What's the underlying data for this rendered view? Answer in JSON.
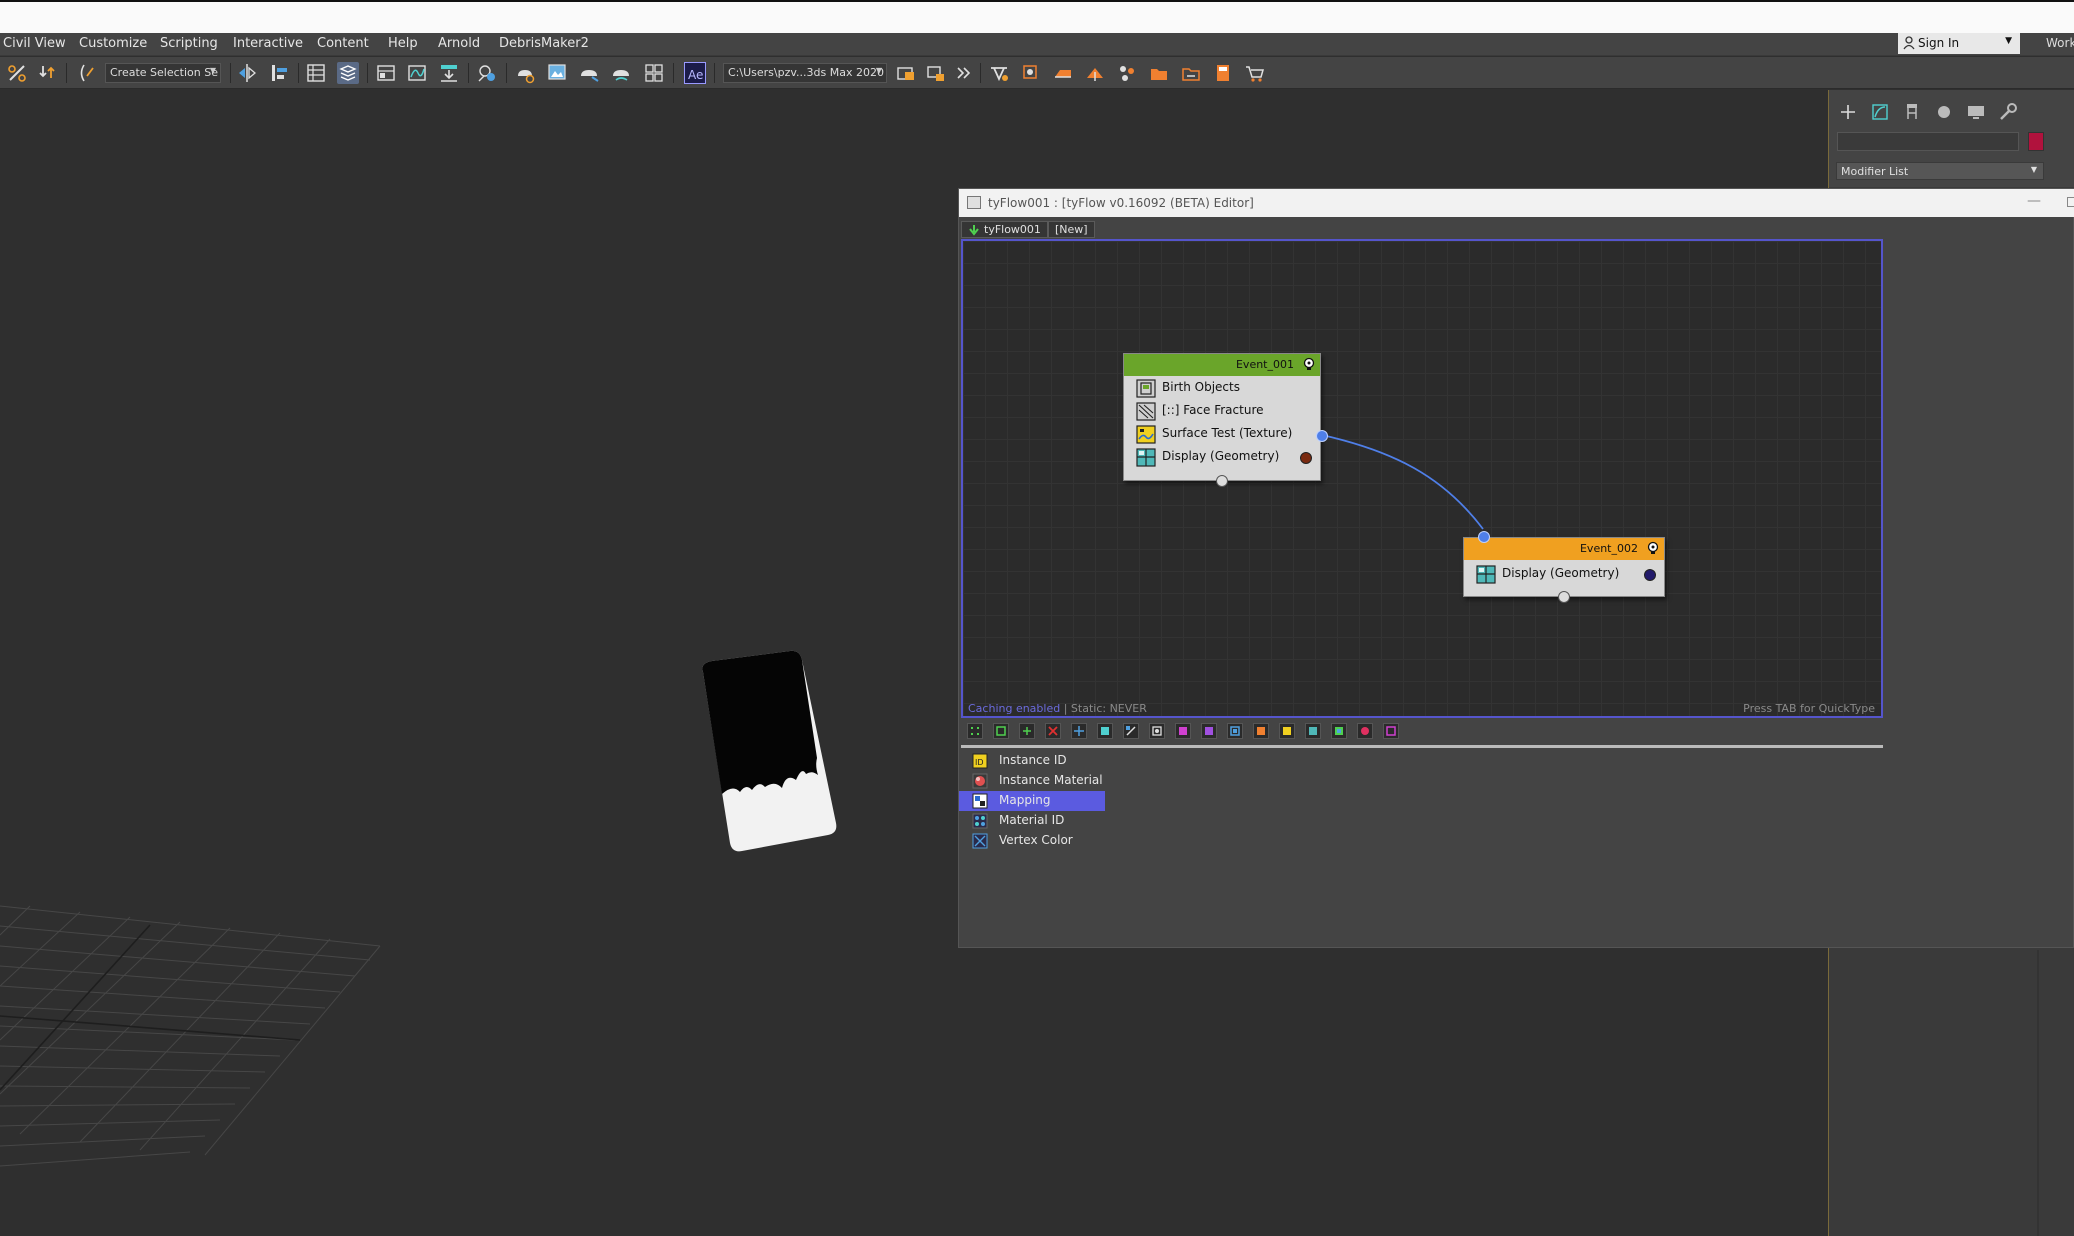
{
  "menubar": {
    "items": [
      "Civil View",
      "Customize",
      "Scripting",
      "Interactive",
      "Content",
      "Help",
      "Arnold",
      "DebrisMaker2"
    ],
    "sign_in": "Sign In",
    "workspace_partial": "Work"
  },
  "toolbar": {
    "selection_set": "Create Selection Se",
    "project_path": "C:\\Users\\pzv...3ds Max 2020"
  },
  "command_panel": {
    "tab_icons": [
      "create-icon",
      "modify-icon",
      "hierarchy-icon",
      "motion-icon",
      "display-icon",
      "utilities-icon"
    ],
    "object_color": "#b1123d",
    "modifier_list": "Modifier List"
  },
  "editor": {
    "title": "tyFlow001 : [tyFlow v0.16092 (BETA) Editor]",
    "tabs": [
      {
        "label": "tyFlow001"
      },
      {
        "label": "[New]"
      }
    ],
    "status_caching": "Caching enabled",
    "status_separator": " | ",
    "status_static": "Static: NEVER",
    "hint": "Press TAB for QuickType",
    "events": [
      {
        "name": "Event_001",
        "header_color": "#6aa52a",
        "operators": [
          {
            "label": "Birth Objects",
            "icon": "birth-objects-icon"
          },
          {
            "label": "[::] Face Fracture",
            "icon": "face-fracture-icon"
          },
          {
            "label": "Surface Test (Texture)",
            "icon": "surface-test-icon"
          },
          {
            "label": "Display (Geometry)",
            "icon": "display-geometry-icon",
            "dot_color": "#7a2a10"
          }
        ]
      },
      {
        "name": "Event_002",
        "header_color": "#f0a020",
        "operators": [
          {
            "label": "Display (Geometry)",
            "icon": "display-geometry-icon",
            "dot_color": "#221a6a"
          }
        ]
      }
    ],
    "wire_color": "#4f7fe8",
    "operator_list": [
      {
        "label": "Instance ID",
        "icon": "instance-id-icon",
        "selected": false
      },
      {
        "label": "Instance Material",
        "icon": "instance-material-icon",
        "selected": false
      },
      {
        "label": "Mapping",
        "icon": "mapping-icon",
        "selected": true
      },
      {
        "label": "Material ID",
        "icon": "material-id-icon",
        "selected": false
      },
      {
        "label": "Vertex Color",
        "icon": "vertex-color-icon",
        "selected": false
      }
    ]
  }
}
